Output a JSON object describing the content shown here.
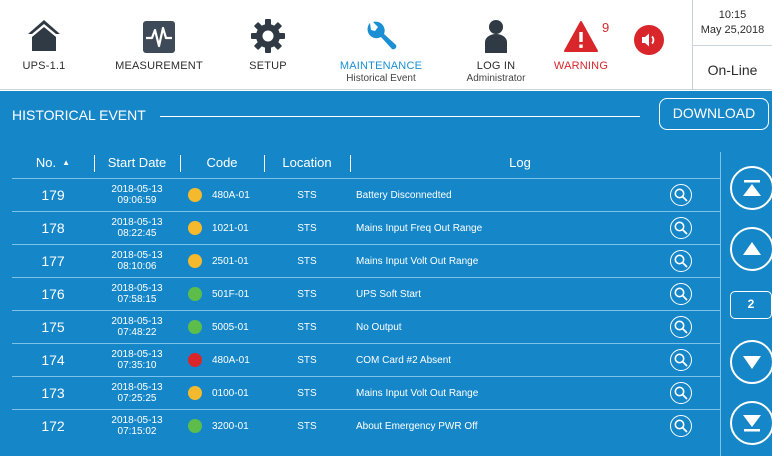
{
  "nav": {
    "items": [
      {
        "label": "UPS-1.1",
        "sub": ""
      },
      {
        "label": "MEASUREMENT",
        "sub": ""
      },
      {
        "label": "SETUP",
        "sub": ""
      },
      {
        "label": "MAINTENANCE",
        "sub": "Historical Event"
      },
      {
        "label": "LOG IN",
        "sub": "Administrator"
      },
      {
        "label": "WARNING",
        "sub": ""
      }
    ],
    "warning_count": "9",
    "active_color": "#1b8fd3",
    "warning_color": "#d8262b"
  },
  "status": {
    "time": "10:15",
    "date": "May 25,2018",
    "mode": "On-Line"
  },
  "panel": {
    "title": "HISTORICAL EVENT",
    "download_label": "DOWNLOAD",
    "background": "#1587c9"
  },
  "table": {
    "headers": {
      "no": "No.",
      "start_date": "Start Date",
      "code": "Code",
      "location": "Location",
      "log": "Log"
    },
    "rows": [
      {
        "no": "179",
        "date": "2018-05-13",
        "time": "09:06:59",
        "status": "yellow",
        "code": "480A-01",
        "location": "STS",
        "log": "Battery Disconnedted"
      },
      {
        "no": "178",
        "date": "2018-05-13",
        "time": "08:22:45",
        "status": "yellow",
        "code": "1021-01",
        "location": "STS",
        "log": "Mains Input Freq Out Range"
      },
      {
        "no": "177",
        "date": "2018-05-13",
        "time": "08:10:06",
        "status": "yellow",
        "code": "2501-01",
        "location": "STS",
        "log": "Mains Input Volt Out Range"
      },
      {
        "no": "176",
        "date": "2018-05-13",
        "time": "07:58:15",
        "status": "green",
        "code": "501F-01",
        "location": "STS",
        "log": "UPS Soft Start"
      },
      {
        "no": "175",
        "date": "2018-05-13",
        "time": "07:48:22",
        "status": "green",
        "code": "5005-01",
        "location": "STS",
        "log": "No Output"
      },
      {
        "no": "174",
        "date": "2018-05-13",
        "time": "07:35:10",
        "status": "red",
        "code": "480A-01",
        "location": "STS",
        "log": "COM Card #2 Absent"
      },
      {
        "no": "173",
        "date": "2018-05-13",
        "time": "07:25:25",
        "status": "yellow",
        "code": "0100-01",
        "location": "STS",
        "log": "Mains Input Volt Out Range"
      },
      {
        "no": "172",
        "date": "2018-05-13",
        "time": "07:15:02",
        "status": "green",
        "code": "3200-01",
        "location": "STS",
        "log": "About Emergency PWR Off"
      }
    ],
    "status_colors": {
      "yellow": "#f4b92d",
      "green": "#5cbd4b",
      "red": "#d8262b"
    }
  },
  "pager": {
    "current_page": "2",
    "icons": [
      "first-page-icon",
      "previous-page-icon",
      "next-page-icon",
      "last-page-icon"
    ]
  }
}
